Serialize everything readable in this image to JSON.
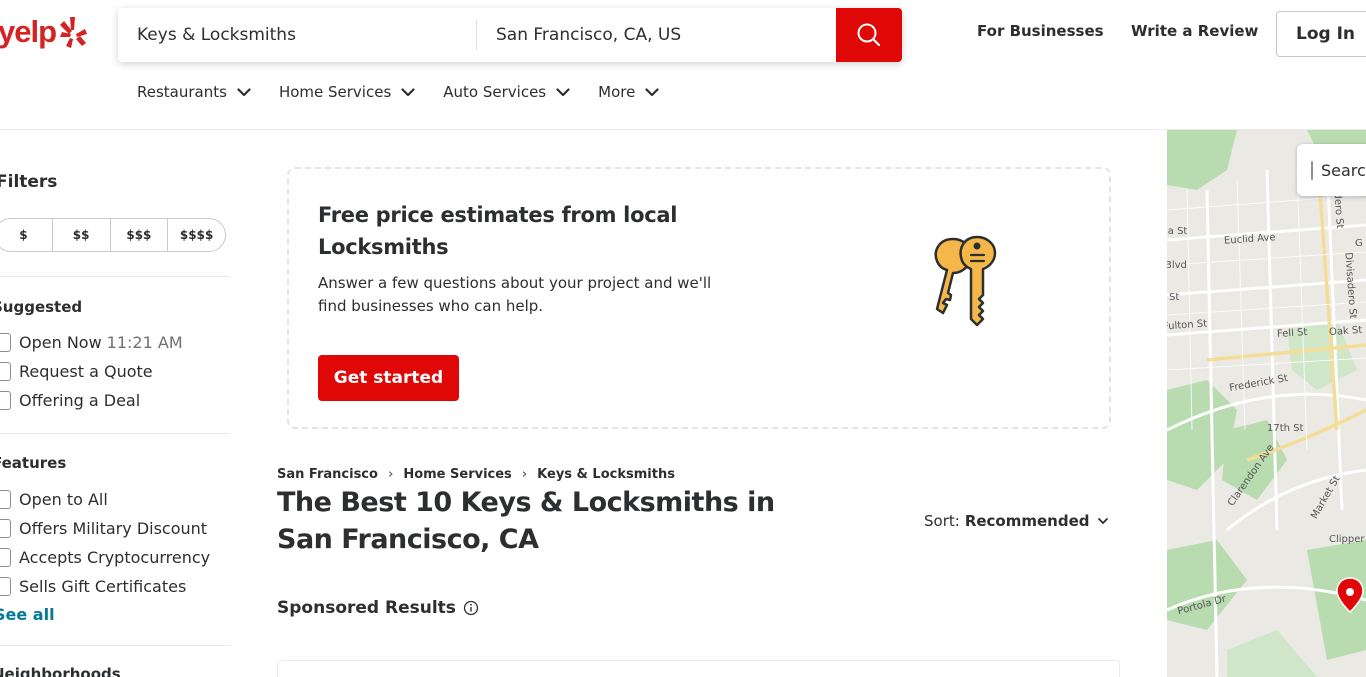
{
  "header": {
    "logo_text": "yelp",
    "search": {
      "find_value": "Keys & Locksmiths",
      "near_value": "San Francisco, CA, US"
    },
    "links": {
      "for_businesses": "For Businesses",
      "write_review": "Write a Review",
      "login": "Log In"
    },
    "categories": [
      "Restaurants",
      "Home Services",
      "Auto Services",
      "More"
    ]
  },
  "filters": {
    "title": "Filters",
    "price": [
      "$",
      "$$",
      "$$$",
      "$$$$"
    ],
    "suggested": {
      "title": "Suggested",
      "open_now": "Open Now",
      "open_now_time": "11:21 AM",
      "request_quote": "Request a Quote",
      "offering_deal": "Offering a Deal"
    },
    "features": {
      "title": "Features",
      "items": [
        "Open to All",
        "Offers Military Discount",
        "Accepts Cryptocurrency",
        "Sells Gift Certificates"
      ],
      "see_all": "See all"
    },
    "neighborhoods": {
      "title": "Neighborhoods"
    }
  },
  "promo": {
    "title": "Free price estimates from local Locksmiths",
    "description": "Answer a few questions about your project and we'll find businesses who can help.",
    "cta": "Get started"
  },
  "breadcrumb": [
    "San Francisco",
    "Home Services",
    "Keys & Locksmiths"
  ],
  "results": {
    "title": "The Best 10 Keys & Locksmiths in San Francisco, CA",
    "sort_label": "Sort:",
    "sort_value": "Recommended",
    "sponsored_label": "Sponsored Results"
  },
  "map": {
    "toggle_label": "Search as map moves",
    "streets": [
      "Euclid Ave",
      "Divisadero St",
      "Fell St",
      "Oak St",
      "Frederick St",
      "17th St",
      "Clarendon Ave",
      "Market St",
      "Clipper",
      "Portola Dr",
      "Fulton St",
      "Blvd",
      "St",
      "ia St",
      "adero St",
      "G"
    ]
  },
  "colors": {
    "brand_red": "#d32323",
    "button_red": "#e00707",
    "link_teal": "#027a97"
  }
}
